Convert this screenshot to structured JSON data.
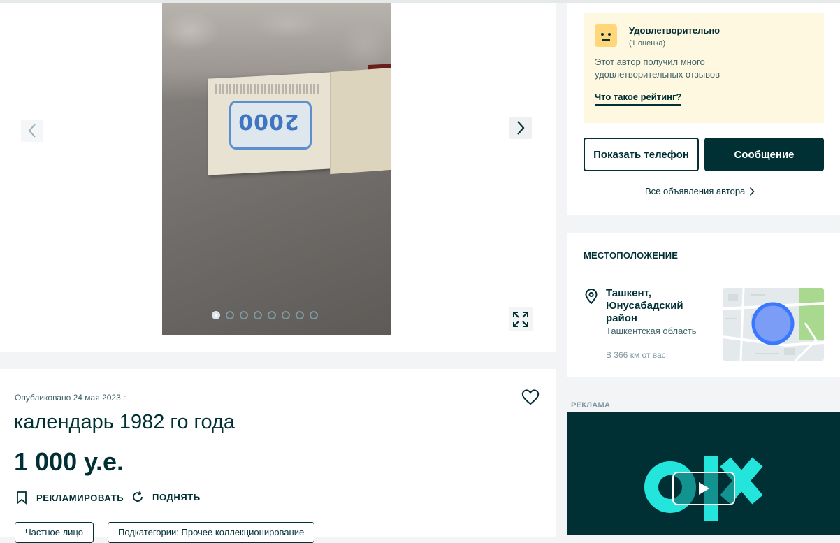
{
  "gallery": {
    "photo_count": 8,
    "active_photo": 1,
    "photo_year_text": "2000",
    "prev_label": "‹",
    "next_label": "›"
  },
  "listing": {
    "published": "Опубликовано 24 мая 2023 г.",
    "title": "календарь 1982 го года",
    "price": "1 000 у.е.",
    "promote_label": "РЕКЛАМИРОВАТЬ",
    "raise_label": "ПОДНЯТЬ",
    "tags": [
      "Частное лицо",
      "Подкатегории: Прочее коллекционирование"
    ]
  },
  "seller": {
    "rating_title": "Удовлетворительно",
    "rating_count": "(1 оценка)",
    "rating_desc": "Этот автор получил много удовлетворительных отзывов",
    "rating_link": "Что такое рейтинг?",
    "phone_button": "Показать телефон",
    "message_button": "Сообщение",
    "all_ads_link": "Все объявления автора"
  },
  "location": {
    "section_title": "МЕСТОПОЛОЖЕНИЕ",
    "city": "Ташкент, Юнусабадский район",
    "region": "Ташкентская область",
    "distance": "В 366 км от вас"
  },
  "ad": {
    "label": "РЕКЛАМА",
    "brand": "olx"
  },
  "colors": {
    "primary": "#002f34",
    "rating_bg": "#fff8e1",
    "face": "#ffd77a",
    "olx_teal": "#23e5db",
    "map_circle": "#3a77ff"
  },
  "icons": {
    "prev": "chevron-left-icon",
    "next": "chevron-right-icon",
    "expand": "expand-icon",
    "favorite": "heart-icon",
    "promote": "bookmark-icon",
    "raise": "refresh-icon",
    "location": "pin-icon",
    "all_ads": "chevron-right-icon",
    "video": "play-icon"
  }
}
